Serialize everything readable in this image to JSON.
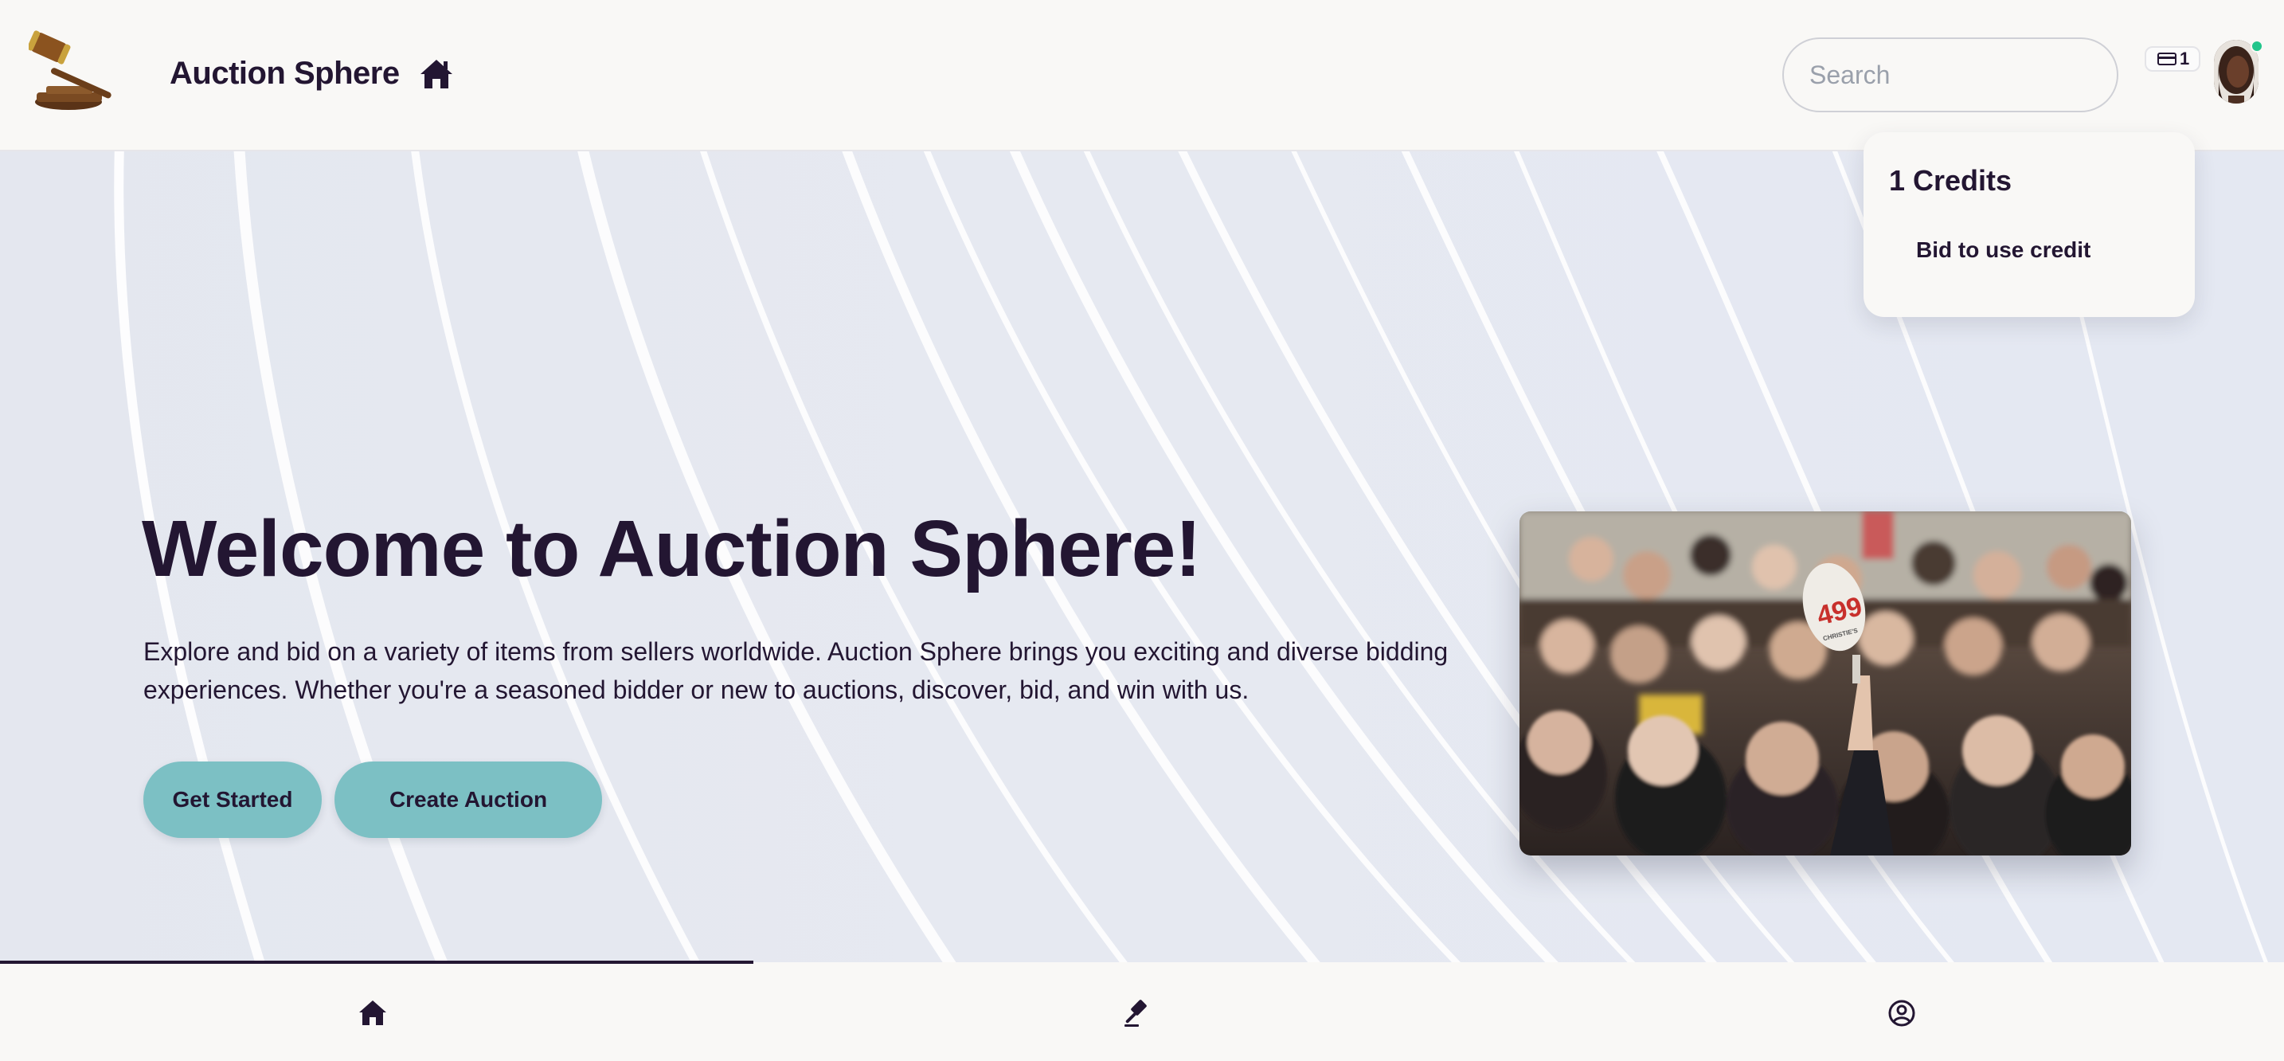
{
  "header": {
    "brand_title": "Auction Sphere",
    "search_placeholder": "Search",
    "credits_count": "1"
  },
  "credits_menu": {
    "title": "1 Credits",
    "item": "Bid to use credit"
  },
  "hero": {
    "title": "Welcome to Auction Sphere!",
    "description": "Explore and bid on a variety of items from sellers worldwide. Auction Sphere brings you exciting and diverse bidding experiences. Whether you're a seasoned bidder or new to auctions, discover, bid, and win with us.",
    "primary_button": "Get Started",
    "secondary_button": "Create Auction",
    "paddle_number": "499",
    "paddle_brand": "CHRISTIE'S"
  },
  "bottom_nav": {
    "progress": 0.33,
    "items": [
      "home-icon",
      "gavel-icon",
      "profile-icon"
    ]
  },
  "colors": {
    "primary_text": "#231632",
    "accent_button": "#7cc0c4",
    "online_dot": "#22c58b",
    "page_bg": "#f9f8f6"
  }
}
